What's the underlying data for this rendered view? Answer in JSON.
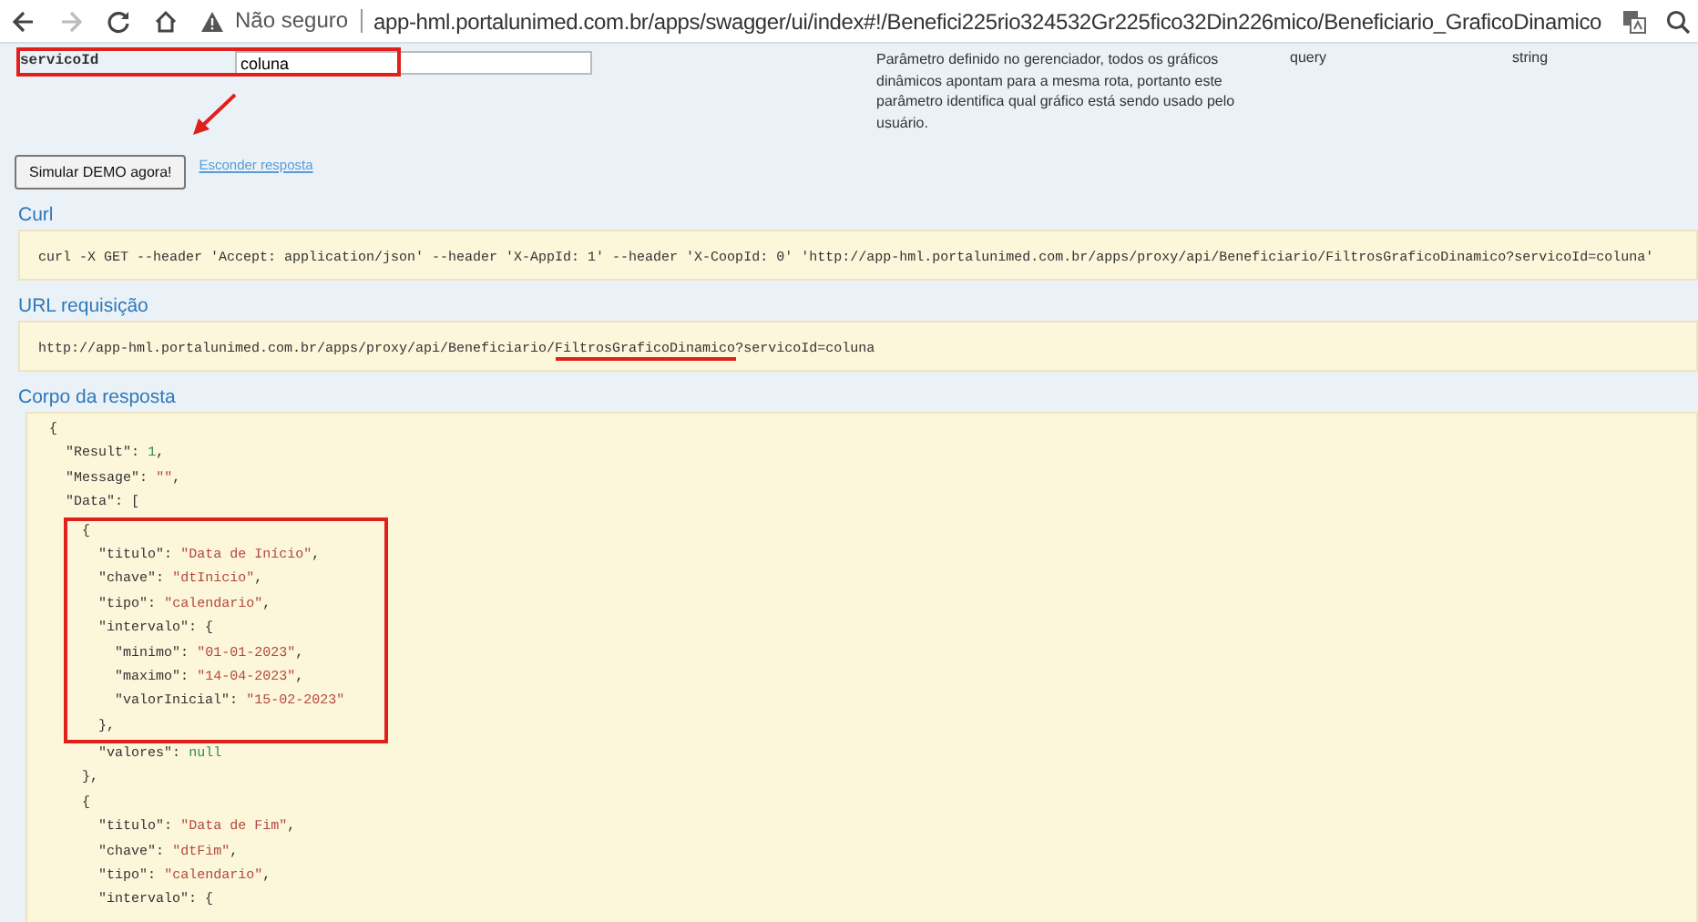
{
  "browser": {
    "security_label": "Não seguro",
    "url": "app-hml.portalunimed.com.br/apps/swagger/ui/index#!/Benefici225rio324532Gr225fico32Din226mico/Beneficiario_GraficoDinamico",
    "forward_disabled": true
  },
  "parameter": {
    "name": "servicoId",
    "value": "coluna",
    "highlighted": true,
    "description": "Parâmetro definido no gerenciador, todos os gráficos dinâmicos apontam para a mesma rota, portanto este parâmetro identifica qual gráfico está sendo usado pelo usuário.",
    "parameter_type": "query",
    "data_type": "string"
  },
  "actions": {
    "submit_button": "Simular DEMO agora!",
    "hide_link": "Esconder resposta",
    "arrow_annotation": true
  },
  "curl": {
    "heading": "Curl",
    "command": "curl -X GET --header 'Accept: application/json' --header 'X-AppId: 1' --header 'X-CoopId: 0' 'http://app-hml.portalunimed.com.br/apps/proxy/api/Beneficiario/FiltrosGraficoDinamico?servicoId=coluna'"
  },
  "request_url": {
    "heading": "URL requisição",
    "parts": [
      {
        "text": "http://app-hml.portalunimed.com.br/apps/proxy/api/Beneficiario/",
        "underlined": false
      },
      {
        "text": "FiltrosGraficoDinamico",
        "underlined": true
      },
      {
        "text": "?servicoId=coluna",
        "underlined": false
      }
    ]
  },
  "response_body": {
    "heading": "Corpo da resposta",
    "lines": [
      {
        "text": "{",
        "highlighted": false
      },
      {
        "text": "  \"Result\": 1,",
        "highlighted": false
      },
      {
        "text": "  \"Message\": \"\",",
        "highlighted": false
      },
      {
        "text": "  \"Data\": [",
        "highlighted": false
      },
      {
        "text": "    {",
        "highlighted": true
      },
      {
        "text": "      \"titulo\": \"Data de Início\",",
        "highlighted": true
      },
      {
        "text": "      \"chave\": \"dtInicio\",",
        "highlighted": true
      },
      {
        "text": "      \"tipo\": \"calendario\",",
        "highlighted": true
      },
      {
        "text": "      \"intervalo\": {",
        "highlighted": true
      },
      {
        "text": "        \"minimo\": \"01-01-2023\",",
        "highlighted": true
      },
      {
        "text": "        \"maximo\": \"14-04-2023\",",
        "highlighted": true
      },
      {
        "text": "        \"valorInicial\": \"15-02-2023\"",
        "highlighted": true
      },
      {
        "text": "      },",
        "highlighted": true
      },
      {
        "text": "      \"valores\": null",
        "highlighted": false
      },
      {
        "text": "    },",
        "highlighted": false
      },
      {
        "text": "    {",
        "highlighted": false
      },
      {
        "text": "      \"titulo\": \"Data de Fim\",",
        "highlighted": false
      },
      {
        "text": "      \"chave\": \"dtFim\",",
        "highlighted": false
      },
      {
        "text": "      \"tipo\": \"calendario\",",
        "highlighted": false
      },
      {
        "text": "      \"intervalo\": {",
        "highlighted": false
      }
    ]
  }
}
